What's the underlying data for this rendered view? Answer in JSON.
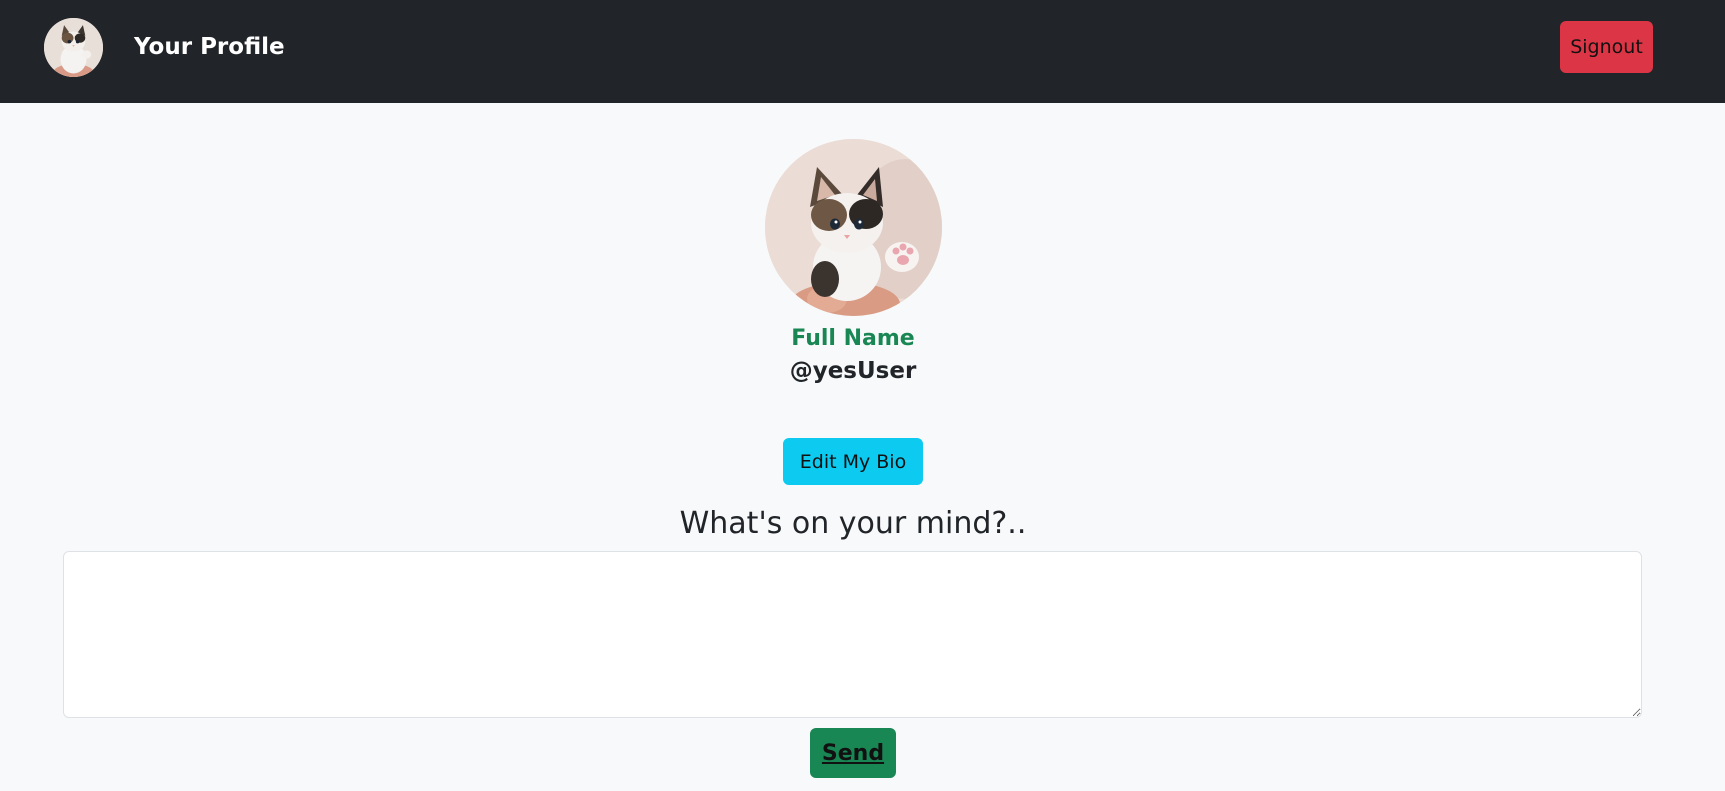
{
  "navbar": {
    "title": "Your Profile",
    "signout_label": "Signout"
  },
  "profile": {
    "full_name": "Full Name",
    "username": "@yesUser",
    "edit_bio_label": "Edit My Bio"
  },
  "post": {
    "prompt": "What's on your mind?..",
    "text_value": "",
    "send_label": "Send"
  },
  "colors": {
    "navbar_bg": "#212529",
    "signout": "#dc3545",
    "edit_bio": "#0dcaf0",
    "send": "#198754",
    "full_name": "#198754"
  },
  "icons": {
    "nav_avatar": "kitten-avatar-icon",
    "profile_avatar": "kitten-photo"
  }
}
